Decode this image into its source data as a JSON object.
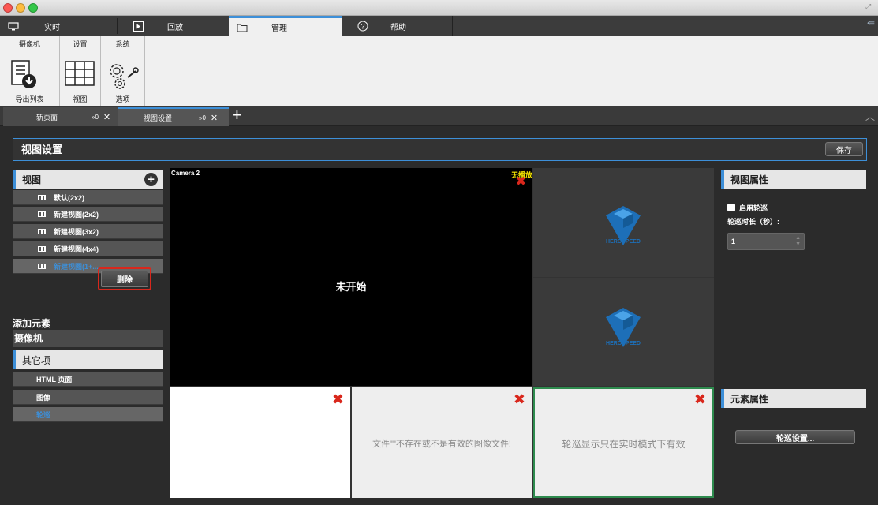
{
  "menu": {
    "tabs": [
      {
        "label": "实时",
        "icon": "monitor-icon"
      },
      {
        "label": "回放",
        "icon": "play-icon"
      },
      {
        "label": "管理",
        "icon": "folder-icon"
      },
      {
        "label": "帮助",
        "icon": "help-icon"
      }
    ],
    "active": "管理"
  },
  "ribbon": {
    "groups": [
      {
        "header": "摄像机",
        "label": "导出列表",
        "icon": "export-list-icon"
      },
      {
        "header": "设置",
        "label": "视图",
        "icon": "view-grid-icon"
      },
      {
        "header": "系统",
        "label": "选项",
        "icon": "options-gear-icon"
      }
    ]
  },
  "doc_tabs": [
    {
      "label": "新页面",
      "pin": "»0",
      "close": "✕"
    },
    {
      "label": "视图设置",
      "pin": "»0",
      "close": "✕"
    }
  ],
  "add_tab": "+",
  "header": {
    "title": "视图设置",
    "save": "保存"
  },
  "views_panel": {
    "title": "视图",
    "add": "+",
    "items": [
      "默认(2x2)",
      "新建视图(2x2)",
      "新建视图(3x2)",
      "新建视图(4x4)",
      "新建视图(1+..."
    ],
    "context_menu": "删除"
  },
  "elements_panel": {
    "title": "添加元素",
    "camera": "摄像机",
    "other": "其它项",
    "items": [
      "HTML 页面",
      "图像",
      "轮巡"
    ]
  },
  "grid": {
    "camera_name": "Camera 2",
    "no_playback": "无播放",
    "not_started": "未开始",
    "logo_text": "HEROSPEED",
    "image_error": "文件\"\"不存在或不是有效的图像文件!",
    "tour_note": "轮巡显示只在实时模式下有效"
  },
  "view_props": {
    "title": "视图属性",
    "enable_tour": "启用轮巡",
    "tour_duration_label": "轮巡时长（秒）:",
    "tour_duration_value": "1"
  },
  "element_props": {
    "title": "元素属性",
    "tour_settings": "轮巡设置..."
  }
}
